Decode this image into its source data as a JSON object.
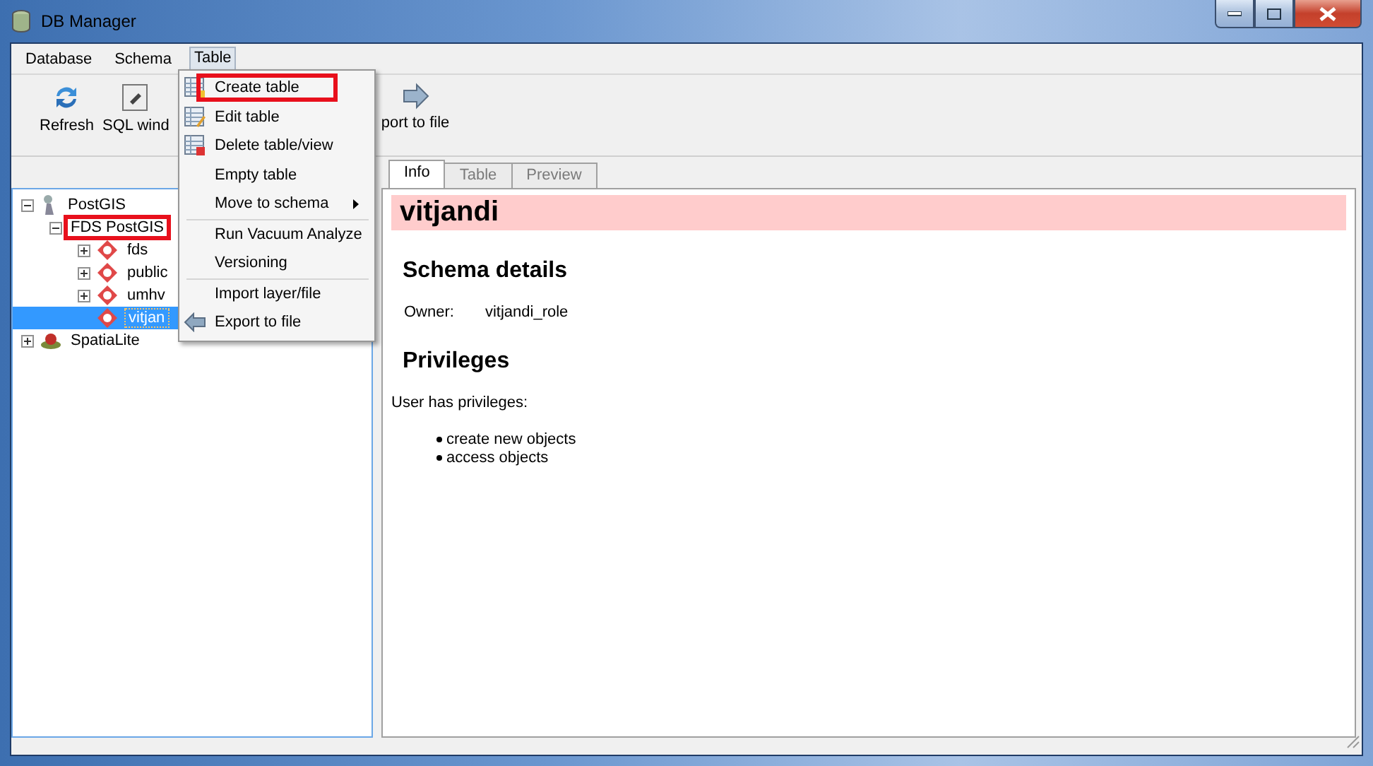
{
  "window": {
    "title": "DB Manager"
  },
  "menubar": [
    {
      "label": "Database",
      "selected": false
    },
    {
      "label": "Schema",
      "selected": false
    },
    {
      "label": "Table",
      "selected": true
    }
  ],
  "toolbar": [
    {
      "label": "Refresh",
      "kind": "refresh"
    },
    {
      "label": "SQL wind",
      "kind": "sql"
    },
    {
      "label": "port to file",
      "kind": "export"
    }
  ],
  "tree": [
    {
      "label": "PostGIS",
      "kind": "server",
      "expanded": true,
      "selected": false,
      "annotated": false,
      "children": [
        {
          "label": "FDS PostGIS",
          "expanded": true,
          "selected": false,
          "annotated": true,
          "children": [
            {
              "label": "fds",
              "kind": "schema",
              "expanded": false,
              "selected": false,
              "annotated": false
            },
            {
              "label": "public",
              "kind": "schema",
              "expanded": false,
              "selected": false,
              "annotated": false
            },
            {
              "label": "umhv",
              "kind": "schema",
              "expanded": false,
              "selected": false,
              "annotated": false
            },
            {
              "label": "vitjan",
              "kind": "schema",
              "selected": true,
              "annotated": false
            }
          ]
        }
      ]
    },
    {
      "label": "SpatiaLite",
      "kind": "spatialite",
      "expanded": false,
      "selected": false,
      "annotated": false
    }
  ],
  "tabs": [
    {
      "label": "Info",
      "selected": true
    },
    {
      "label": "Table",
      "selected": false
    },
    {
      "label": "Preview",
      "selected": false
    }
  ],
  "info": {
    "title": "vitjandi",
    "sections": [
      {
        "heading": "Schema details",
        "owner_label": "Owner:",
        "owner_value": "vitjandi_role"
      },
      {
        "heading": "Privileges",
        "intro": "User has privileges:",
        "bullets": [
          "create new objects",
          "access objects"
        ]
      }
    ]
  },
  "menu": [
    {
      "kind": "action",
      "label": "Create table",
      "annotated": true,
      "submenu": false
    },
    {
      "kind": "action",
      "label": "Edit table",
      "annotated": false,
      "submenu": false
    },
    {
      "kind": "action",
      "label": "Delete table/view",
      "annotated": false,
      "submenu": false
    },
    {
      "kind": "action",
      "label": "Empty table",
      "annotated": false,
      "submenu": false
    },
    {
      "kind": "action",
      "label": "Move to schema",
      "annotated": false,
      "submenu": true
    },
    {
      "kind": "separator"
    },
    {
      "kind": "action",
      "label": "Run Vacuum Analyze",
      "annotated": false,
      "submenu": false
    },
    {
      "kind": "action",
      "label": "Versioning",
      "annotated": false,
      "submenu": false
    },
    {
      "kind": "separator"
    },
    {
      "kind": "action",
      "label": "Import layer/file",
      "annotated": false,
      "submenu": false
    },
    {
      "kind": "action",
      "label": "Export to file",
      "annotated": false,
      "submenu": false
    }
  ]
}
